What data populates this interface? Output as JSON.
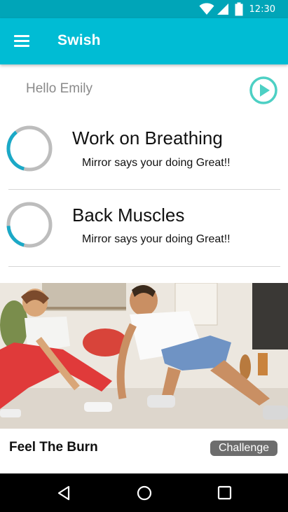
{
  "status_bar": {
    "time": "12:30",
    "icons": [
      "wifi-icon",
      "signal-icon",
      "battery-icon"
    ],
    "background": "#00a5b8"
  },
  "app_bar": {
    "title": "Swish",
    "menu_icon": "hamburger-menu-icon",
    "background": "#00bcd4"
  },
  "greeting": {
    "text": "Hello Emily",
    "play_icon": "play-circle-icon",
    "play_color": "#4dd0c4"
  },
  "progress_items": [
    {
      "title": "Work on Breathing",
      "subtitle": "Mirror says your doing Great!!",
      "progress": 0.35,
      "color": "#1ba9c7",
      "track_color": "#bdbdbd"
    },
    {
      "title": "Back Muscles",
      "subtitle": "Mirror says your doing Great!!",
      "progress": 0.2,
      "color": "#1ba9c7",
      "track_color": "#bdbdbd"
    }
  ],
  "card": {
    "image": "two-people-stretching-photo",
    "title": "Feel The Burn",
    "tag": "Challenge",
    "tag_color": "#6d6d6d"
  },
  "nav_bar": {
    "icons": [
      "back-icon",
      "home-icon",
      "recents-icon"
    ]
  }
}
